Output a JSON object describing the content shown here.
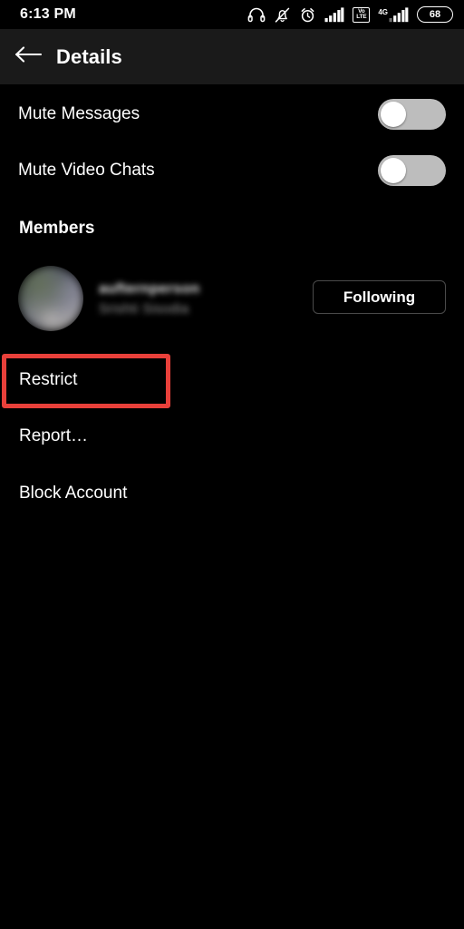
{
  "status_bar": {
    "time": "6:13 PM",
    "battery_level": "68",
    "network_type": "4G",
    "volte_top": "Vo",
    "volte_bottom": "LTE",
    "icons": [
      "headphones-icon",
      "notifications-off-icon",
      "alarm-icon",
      "signal-bars-icon",
      "volte-icon",
      "signal-bars-icon",
      "battery-icon"
    ]
  },
  "app_bar": {
    "back_icon": "arrow-left-icon",
    "title": "Details"
  },
  "settings": {
    "mute_messages": {
      "label": "Mute Messages",
      "state": "off"
    },
    "mute_video_chats": {
      "label": "Mute Video Chats",
      "state": "off"
    }
  },
  "members": {
    "section_title": "Members",
    "entries": [
      {
        "username": "aufternperson",
        "full_name": "Srishti Sisodia",
        "avatar": "user-avatar",
        "action_label": "Following"
      }
    ]
  },
  "actions": [
    {
      "label": "Restrict",
      "name": "restrict"
    },
    {
      "label": "Report…",
      "name": "report"
    },
    {
      "label": "Block Account",
      "name": "block-account"
    }
  ],
  "highlight": {
    "target": "Restrict",
    "color": "#e8403a"
  },
  "colors": {
    "background": "#000000",
    "app_bar": "#1a1a1a",
    "text_primary": "#ffffff",
    "text_secondary": "#9a9a9a",
    "switch_track_off": "#bdbdbd",
    "switch_knob": "#ffffff",
    "button_border": "#4a4a4a",
    "highlight_red": "#e8403a"
  }
}
